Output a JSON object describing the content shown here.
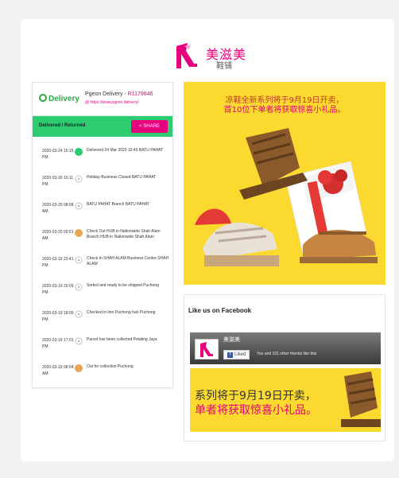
{
  "brand": {
    "name_cn": "美滋美",
    "sub_cn": "鞋铺"
  },
  "tracking": {
    "logo_text": "Delivery",
    "title_prefix": "Pgeon Delivery - ",
    "tracking_number": "R1179846",
    "link": "@ https://www.pgeon.delivery/",
    "status": "Delivered / Returned",
    "share_label": "< SHARE",
    "events": [
      {
        "date": "2020-03-24 15:15 PM",
        "icon": "check-icon",
        "desc": "Delivered 24 Mar 2020 15:45 BATU PAHAT"
      },
      {
        "date": "2020-03-30 15:11 PM",
        "icon": "pin-icon",
        "desc": "Holiday-Business Closed BATU PAHAT"
      },
      {
        "date": "2020-03-20 08:58 AM",
        "icon": "pin-icon",
        "desc": "BATU PAHAT Branch BATU PAHAT"
      },
      {
        "date": "2020-03-20 00:51 AM",
        "icon": "box-icon",
        "desc": "Check Out HUB in Nationwide Shah Alam Branch HUB in Nationwide Shah Alam"
      },
      {
        "date": "2020-03-19 23:41 PM",
        "icon": "pin-icon",
        "desc": "Check In SHAH ALAM Business Centre SHAH ALAM"
      },
      {
        "date": "2020-03-19 20:09 PM",
        "icon": "pin-icon",
        "desc": "Sorted and ready to be shipped Puchong"
      },
      {
        "date": "2020-03-19 18:09 PM",
        "icon": "pin-icon",
        "desc": "Checked in into Puchong hub Puchong"
      },
      {
        "date": "2020-03-19 17:01 PM",
        "icon": "pin-icon",
        "desc": "Parcel has been collected Petaling Jaya"
      },
      {
        "date": "2020-03-19 08:04 AM",
        "icon": "box-icon",
        "desc": "Out for collection Puchong"
      }
    ]
  },
  "promo": {
    "line1": "凉鞋全新系列将于9月19日开卖，",
    "line2": "首10位下单者将获取惊喜小礼品。"
  },
  "facebook": {
    "title": "Like us on Facebook",
    "page_name": "美滋美",
    "like_label": "Liked",
    "friends_text": "You and 101 other friends like this",
    "cover_line1": "系列将于9月19日开卖，",
    "cover_line2": "单者将获取惊喜小礼品。"
  },
  "colors": {
    "accent": "#e6007e",
    "status_green": "#2ecc71",
    "promo_yellow": "#fbd92f",
    "facebook_blue": "#3b5998"
  }
}
